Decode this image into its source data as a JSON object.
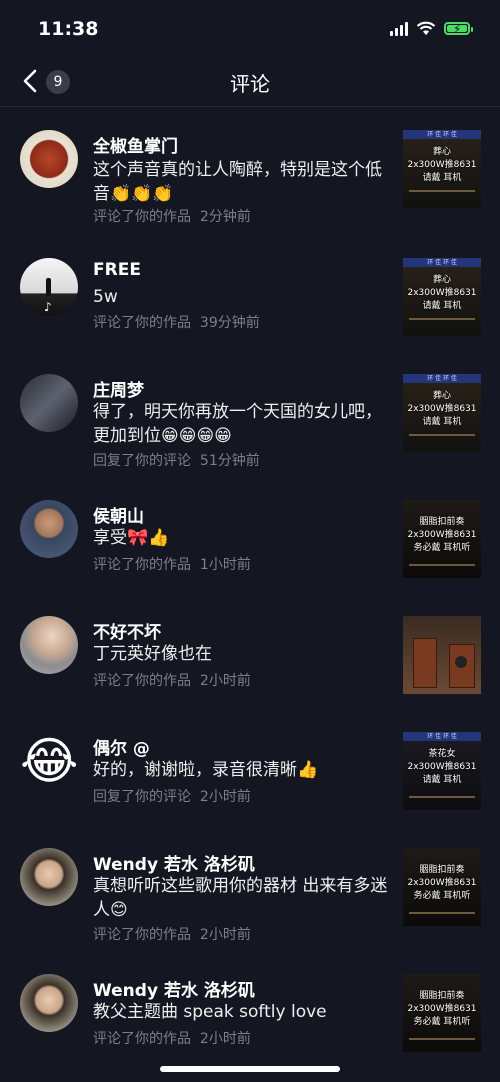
{
  "status": {
    "time": "11:38"
  },
  "header": {
    "title": "评论",
    "back_count": "9"
  },
  "comments": [
    {
      "name": "全椒鱼掌门",
      "text": "这个声音真的让人陶醉，特别是这个低音👏👏👏",
      "action": "评论了你的作品",
      "time": "2分钟前",
      "thumb": {
        "banner": "环  佳  环  佳",
        "lines": [
          "葬心",
          "2x300W推8631",
          "请戴   耳机"
        ]
      }
    },
    {
      "name": "FREE",
      "text": "5w",
      "action": "评论了你的作品",
      "time": "39分钟前",
      "thumb": {
        "banner": "环  佳  环  佳",
        "lines": [
          "葬心",
          "2x300W推8631",
          "请戴   耳机"
        ]
      }
    },
    {
      "name": "庄周梦",
      "text": "得了，明天你再放一个天国的女儿吧，更加到位😁😁😁😁",
      "action": "回复了你的评论",
      "time": "51分钟前",
      "thumb": {
        "banner": "环  佳  环  佳",
        "lines": [
          "葬心",
          "2x300W推8631",
          "请戴   耳机"
        ]
      }
    },
    {
      "name": "侯朝山",
      "text": "享受🎀👍",
      "action": "评论了你的作品",
      "time": "1小时前",
      "thumb": {
        "banner": "",
        "lines": [
          "胭脂扣前奏",
          "2x300W推8631",
          "务必戴  耳机听"
        ]
      }
    },
    {
      "name": "不好不坏",
      "text": "丁元英好像也在",
      "action": "评论了你的作品",
      "time": "2小时前",
      "thumb": {
        "banner": "",
        "lines": []
      }
    },
    {
      "name": "偶尔 @",
      "text": "好的，谢谢啦，录音很清晰👍",
      "action": "回复了你的评论",
      "time": "2小时前",
      "thumb": {
        "banner": "环  佳  环  佳",
        "lines": [
          "茶花女",
          "2x300W推8631",
          "请戴   耳机"
        ]
      }
    },
    {
      "name": "Wendy 若水 洛杉矶",
      "text": "真想听听这些歌用你的器材 出来有多迷人😊",
      "action": "评论了你的作品",
      "time": "2小时前",
      "thumb": {
        "banner": "",
        "lines": [
          "胭脂扣前奏",
          "2x300W推8631",
          "务必戴  耳机听"
        ]
      }
    },
    {
      "name": "Wendy 若水 洛杉矶",
      "text": "教父主题曲 speak softly love",
      "action": "评论了你的作品",
      "time": "2小时前",
      "thumb": {
        "banner": "",
        "lines": [
          "胭脂扣前奏",
          "2x300W推8631",
          "务必戴  耳机听"
        ]
      }
    }
  ]
}
